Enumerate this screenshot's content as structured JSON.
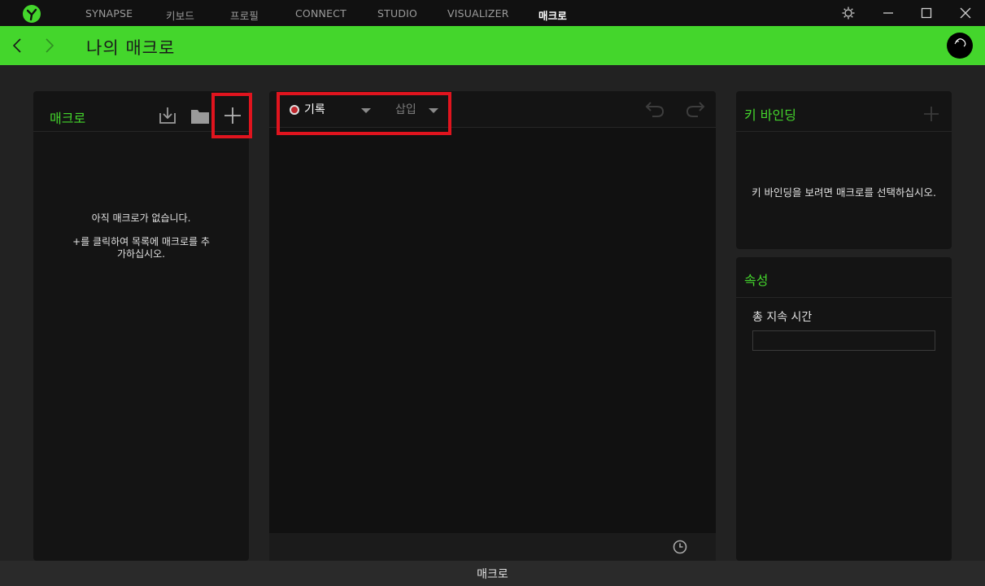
{
  "nav": {
    "items": [
      "SYNAPSE",
      "키보드",
      "프로필",
      "CONNECT",
      "STUDIO",
      "VISUALIZER",
      "매크로"
    ],
    "active": "매크로"
  },
  "window_controls": [
    "settings-icon",
    "minimize-icon",
    "maximize-icon",
    "close-icon"
  ],
  "header": {
    "title": "나의 매크로"
  },
  "macro_panel": {
    "title": "매크로",
    "icons": [
      "import-icon",
      "folder-icon",
      "add-icon"
    ],
    "empty_line1": "아직 매크로가 없습니다.",
    "empty_line2": "+를 클릭하여 목록에 매크로를 추",
    "empty_line3": "가하십시오."
  },
  "editor": {
    "record_label": "기록",
    "insert_label": "삽입",
    "icons": [
      "undo-icon",
      "redo-icon",
      "clock-icon"
    ]
  },
  "key_binding": {
    "title": "키 바인딩",
    "message": "키 바인딩을 보려면 매크로를 선택하십시오."
  },
  "properties": {
    "title": "속성",
    "duration_label": "총 지속 시간",
    "duration_value": ""
  },
  "bottom": {
    "label": "매크로"
  },
  "colors": {
    "accent": "#44d62c",
    "highlight": "#e0141e",
    "record": "#c0272d"
  }
}
